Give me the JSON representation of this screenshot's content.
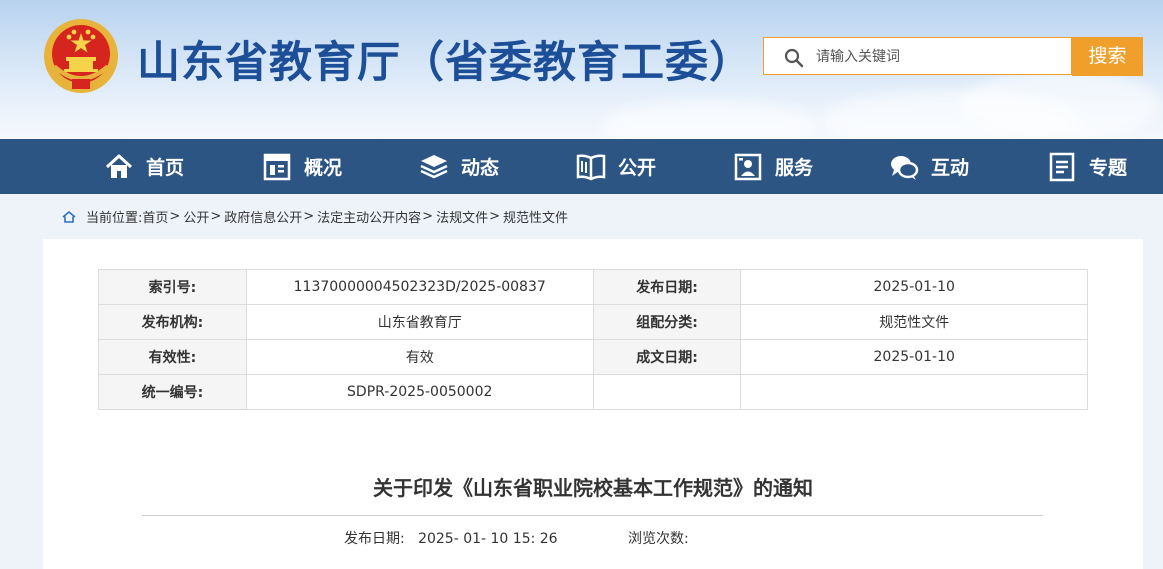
{
  "header": {
    "site_title": "山东省教育厅（省委教育工委）",
    "search_placeholder": "请输入关键词",
    "search_button": "搜索"
  },
  "nav": {
    "items": [
      {
        "label": "首页",
        "icon": "home-icon"
      },
      {
        "label": "概况",
        "icon": "overview-icon"
      },
      {
        "label": "动态",
        "icon": "layers-icon"
      },
      {
        "label": "公开",
        "icon": "book-icon"
      },
      {
        "label": "服务",
        "icon": "service-icon"
      },
      {
        "label": "互动",
        "icon": "chat-icon"
      },
      {
        "label": "专题",
        "icon": "document-icon"
      }
    ]
  },
  "breadcrumb": {
    "prefix": "当前位置:",
    "items": [
      "首页",
      "公开",
      "政府信息公开",
      "法定主动公开内容",
      "法规文件",
      "规范性文件"
    ],
    "separator": ">"
  },
  "info_table": {
    "rows": [
      {
        "k1": "索引号:",
        "v1": "11370000004502323D/2025-00837",
        "k2": "发布日期:",
        "v2": "2025-01-10"
      },
      {
        "k1": "发布机构:",
        "v1": "山东省教育厅",
        "k2": "组配分类:",
        "v2": "规范性文件"
      },
      {
        "k1": "有效性:",
        "v1": "有效",
        "k2": "成文日期:",
        "v2": "2025-01-10"
      },
      {
        "k1": "统一编号:",
        "v1": "SDPR-2025-0050002",
        "k2": "",
        "v2": ""
      }
    ]
  },
  "article": {
    "title": "关于印发《山东省职业院校基本工作规范》的通知",
    "publish_label": "发布日期:",
    "publish_value": "2025- 01- 10 15: 26",
    "views_label": "浏览次数:"
  },
  "colors": {
    "title_blue": "#1c4f97",
    "nav_bg": "#2d5584",
    "accent_orange": "#f0a02a"
  }
}
